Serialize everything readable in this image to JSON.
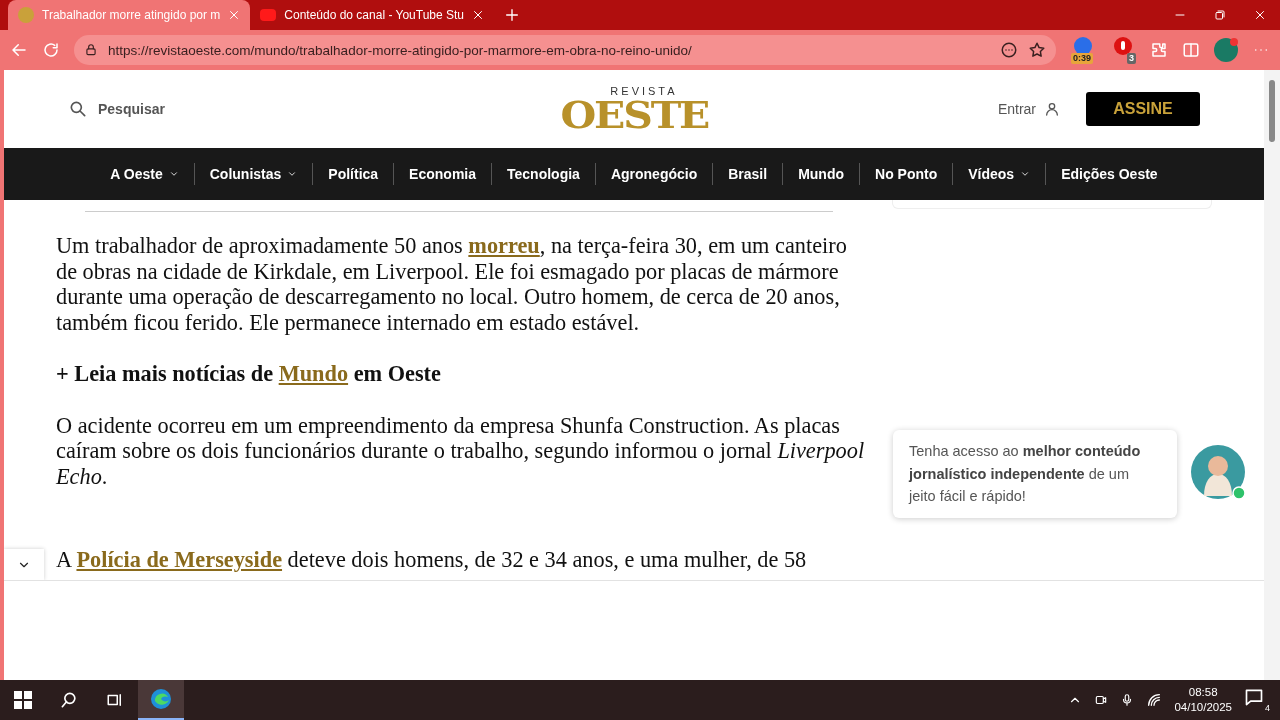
{
  "browser": {
    "tabs": [
      {
        "title": "Trabalhador morre atingido por m",
        "kind": "site",
        "selected": true
      },
      {
        "title": "Conteúdo do canal - YouTube Stu",
        "kind": "video",
        "selected": false
      }
    ],
    "url": "https://revistaoeste.com/mundo/trabalhador-morre-atingido-por-marmore-em-obra-no-reino-unido/",
    "extension_timer": "0:39",
    "extension_count": "3"
  },
  "header": {
    "search_label": "Pesquisar",
    "logo_top": "REVISTA",
    "logo_main": "OESTE",
    "login": "Entrar",
    "subscribe": "ASSINE"
  },
  "nav": [
    {
      "label": "A Oeste",
      "dropdown": true
    },
    {
      "label": "Colunistas",
      "dropdown": true
    },
    {
      "label": "Política",
      "dropdown": false
    },
    {
      "label": "Economia",
      "dropdown": false
    },
    {
      "label": "Tecnologia",
      "dropdown": false
    },
    {
      "label": "Agronegócio",
      "dropdown": false
    },
    {
      "label": "Brasil",
      "dropdown": false
    },
    {
      "label": "Mundo",
      "dropdown": false
    },
    {
      "label": "No Ponto",
      "dropdown": false
    },
    {
      "label": "Vídeos",
      "dropdown": true
    },
    {
      "label": "Edições Oeste",
      "dropdown": false
    }
  ],
  "article": [
    {
      "kind": "body",
      "parts": [
        {
          "kind": "text",
          "text": "Um trabalhador de aproximadamente 50 anos "
        },
        {
          "kind": "link",
          "text": "morreu"
        },
        {
          "kind": "text",
          "text": ", na terça-feira 30, em um canteiro de obras na cidade de Kirkdale, em Liverpool. Ele foi esmagado por placas de mármore durante uma operação de descarregamento no local. Outro homem, de cerca de 20 anos, também ficou ferido. Ele permanece internado em estado estável."
        }
      ]
    },
    {
      "kind": "related",
      "parts": [
        {
          "kind": "text",
          "text": "+ Leia mais notícias de "
        },
        {
          "kind": "link",
          "text": "Mundo"
        },
        {
          "kind": "text",
          "text": " em Oeste"
        }
      ]
    },
    {
      "kind": "body",
      "parts": [
        {
          "kind": "text",
          "text": "O acidente ocorreu em um empreendimento da empresa Shunfa Construction. As placas caíram sobre os dois funcionários durante o trabalho, segundo informou o jornal "
        },
        {
          "kind": "italic",
          "text": "Liverpool Echo"
        },
        {
          "kind": "text",
          "text": "."
        }
      ]
    },
    {
      "kind": "body_spaced",
      "parts": [
        {
          "kind": "text",
          "text": "A "
        },
        {
          "kind": "link",
          "text": "Polícia de Merseyside"
        },
        {
          "kind": "text",
          "text": " deteve dois homens, de 32 e 34 anos, e uma mulher, de 58"
        }
      ]
    }
  ],
  "popup": {
    "text": "Tenha acesso ao **melhor conteúdo jornalístico independente** de um jeito fácil e rápido!",
    "online": true
  },
  "taskbar": {
    "time": "08:58",
    "date": "04/10/2025",
    "notifications": "4"
  }
}
